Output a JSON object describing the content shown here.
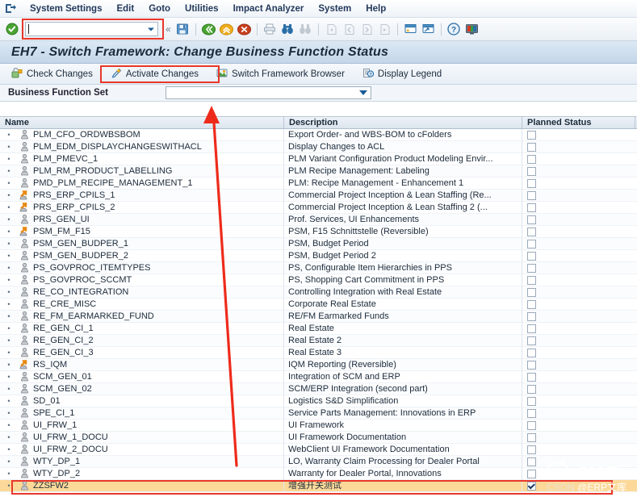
{
  "window": {
    "system_icon": "system-menu-icon"
  },
  "menu": {
    "items": [
      {
        "label": "System Settings"
      },
      {
        "label": "Edit"
      },
      {
        "label": "Goto"
      },
      {
        "label": "Utilities"
      },
      {
        "label": "Impact Analyzer"
      },
      {
        "label": "System"
      },
      {
        "label": "Help"
      }
    ]
  },
  "system_toolbar": {
    "enter_icon": "green-check-enter-icon",
    "okcode": {
      "value": "",
      "placeholder": ""
    },
    "collapse_icon": "double-chevron-left-icon",
    "icons": [
      {
        "name": "save-icon"
      },
      {
        "name": "back-icon"
      },
      {
        "name": "exit-icon"
      },
      {
        "name": "cancel-icon"
      },
      {
        "name": "print-icon"
      },
      {
        "name": "find-icon"
      },
      {
        "name": "find-next-icon"
      },
      {
        "name": "first-page-icon"
      },
      {
        "name": "previous-page-icon"
      },
      {
        "name": "next-page-icon"
      },
      {
        "name": "last-page-icon"
      },
      {
        "name": "create-session-icon"
      },
      {
        "name": "create-shortcut-icon"
      },
      {
        "name": "help-icon"
      },
      {
        "name": "customize-local-layout-icon"
      }
    ]
  },
  "title": "EH7 - Switch Framework: Change Business Function Status",
  "app_toolbar": {
    "buttons": [
      {
        "label": "Check Changes",
        "icon": "check-changes-icon"
      },
      {
        "label": "Activate Changes",
        "icon": "activate-changes-icon"
      },
      {
        "label": "Switch Framework Browser",
        "icon": "switch-framework-browser-icon"
      },
      {
        "label": "Display Legend",
        "icon": "display-legend-icon"
      }
    ],
    "highlighted_button": "Activate Changes"
  },
  "selection": {
    "label": "Business Function Set",
    "value": "",
    "placeholder": ""
  },
  "grid": {
    "columns": [
      "Name",
      "Description",
      "Planned Status"
    ],
    "rows": [
      {
        "name": "PLM_CFO_ORDWBSBOM",
        "icon": "business-function-icon",
        "description": "Export Order- and WBS-BOM to cFolders",
        "checked": false
      },
      {
        "name": "PLM_EDM_DISPLAYCHANGESWITHACL",
        "icon": "business-function-icon",
        "description": "Display Changes to ACL",
        "checked": false
      },
      {
        "name": "PLM_PMEVC_1",
        "icon": "business-function-icon",
        "description": "PLM Variant Configuration Product Modeling Envir...",
        "checked": false
      },
      {
        "name": "PLM_RM_PRODUCT_LABELLING",
        "icon": "business-function-icon",
        "description": "PLM Recipe Management: Labeling",
        "checked": false
      },
      {
        "name": "PMD_PLM_RECIPE_MANAGEMENT_1",
        "icon": "business-function-icon",
        "description": "PLM: Recipe Management - Enhancement 1",
        "checked": false
      },
      {
        "name": "PRS_ERP_CPILS_1",
        "icon": "reversible-function-icon",
        "description": "Commercial Project Inception & Lean Staffing (Re...",
        "checked": false
      },
      {
        "name": "PRS_ERP_CPILS_2",
        "icon": "reversible-function-icon",
        "description": "Commercial Project Inception & Lean Staffing 2 (...",
        "checked": false
      },
      {
        "name": "PRS_GEN_UI",
        "icon": "business-function-icon",
        "description": "Prof. Services, UI Enhancements",
        "checked": false
      },
      {
        "name": "PSM_FM_F15",
        "icon": "reversible-function-icon",
        "description": "PSM, F15 Schnittstelle (Reversible)",
        "checked": false
      },
      {
        "name": "PSM_GEN_BUDPER_1",
        "icon": "business-function-icon",
        "description": "PSM, Budget Period",
        "checked": false
      },
      {
        "name": "PSM_GEN_BUDPER_2",
        "icon": "business-function-icon",
        "description": "PSM, Budget Period 2",
        "checked": false
      },
      {
        "name": "PS_GOVPROC_ITEMTYPES",
        "icon": "business-function-icon",
        "description": "PS, Configurable Item Hierarchies in PPS",
        "checked": false
      },
      {
        "name": "PS_GOVPROC_SCCMT",
        "icon": "business-function-icon",
        "description": "PS, Shopping Cart Commitment in PPS",
        "checked": false
      },
      {
        "name": "RE_CO_INTEGRATION",
        "icon": "business-function-icon",
        "description": "Controlling Integration with Real Estate",
        "checked": false
      },
      {
        "name": "RE_CRE_MISC",
        "icon": "business-function-icon",
        "description": "Corporate Real Estate",
        "checked": false
      },
      {
        "name": "RE_FM_EARMARKED_FUND",
        "icon": "business-function-icon",
        "description": "RE/FM Earmarked Funds",
        "checked": false
      },
      {
        "name": "RE_GEN_CI_1",
        "icon": "business-function-icon",
        "description": "Real Estate",
        "checked": false
      },
      {
        "name": "RE_GEN_CI_2",
        "icon": "business-function-icon",
        "description": "Real Estate 2",
        "checked": false
      },
      {
        "name": "RE_GEN_CI_3",
        "icon": "business-function-icon",
        "description": "Real Estate 3",
        "checked": false
      },
      {
        "name": "RS_IQM",
        "icon": "reversible-function-icon",
        "description": "IQM Reporting (Reversible)",
        "checked": false
      },
      {
        "name": "SCM_GEN_01",
        "icon": "business-function-icon",
        "description": "Integration of SCM and ERP",
        "checked": false
      },
      {
        "name": "SCM_GEN_02",
        "icon": "business-function-icon",
        "description": "SCM/ERP Integration (second part)",
        "checked": false
      },
      {
        "name": "SD_01",
        "icon": "business-function-icon",
        "description": "Logistics S&D Simplification",
        "checked": false
      },
      {
        "name": "SPE_CI_1",
        "icon": "business-function-icon",
        "description": "Service Parts Management: Innovations in ERP",
        "checked": false
      },
      {
        "name": "UI_FRW_1",
        "icon": "business-function-icon",
        "description": "UI Framework",
        "checked": false
      },
      {
        "name": "UI_FRW_1_DOCU",
        "icon": "business-function-icon",
        "description": "UI Framework Documentation",
        "checked": false
      },
      {
        "name": "UI_FRW_2_DOCU",
        "icon": "business-function-icon",
        "description": "WebClient UI Framework Documentation",
        "checked": false
      },
      {
        "name": "WTY_DP_1",
        "icon": "business-function-icon",
        "description": "LO, Warranty Claim Processing for Dealer Portal",
        "checked": false
      },
      {
        "name": "WTY_DP_2",
        "icon": "business-function-icon",
        "description": "Warranty for Dealer Portal, Innovations",
        "checked": false
      },
      {
        "name": "ZZSFW2",
        "icon": "business-function-icon",
        "description": "增强开关测试",
        "checked": true,
        "selected": true
      }
    ]
  },
  "watermark": {
    "logo": "cat-logo-icon",
    "brand": "ERP文库",
    "source": "CSDN",
    "handle": "@ERP文库"
  },
  "colors": {
    "accent_red": "#e8372b",
    "selected_row": "#fcd999",
    "title_bg": "#c3d6e8"
  }
}
